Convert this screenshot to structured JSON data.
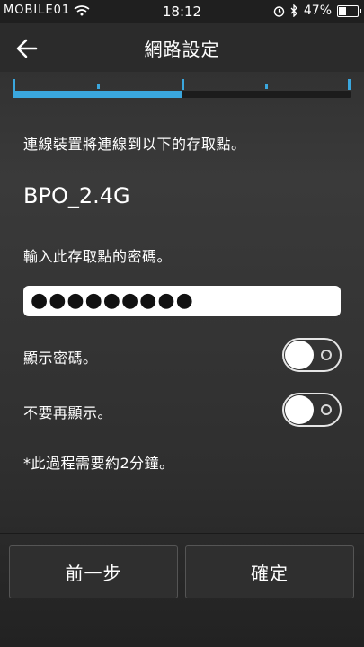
{
  "status_bar": {
    "carrier": "MOBILE01",
    "time": "18:12",
    "battery_percent": "47%",
    "battery_level": 0.47
  },
  "header": {
    "title": "網路設定"
  },
  "progress": {
    "fraction": 0.5
  },
  "content": {
    "instruction": "連線裝置將連線到以下的存取點。",
    "ssid": "BPO_2.4G",
    "password_prompt": "輸入此存取點的密碼。",
    "password_value": "●●●●●●●●●",
    "show_password_label": "顯示密碼。",
    "dont_show_again_label": "不要再顯示。",
    "note": "*此過程需要約2分鐘。"
  },
  "buttons": {
    "back_label": "前一步",
    "confirm_label": "確定"
  },
  "colors": {
    "accent": "#3aa7de"
  }
}
